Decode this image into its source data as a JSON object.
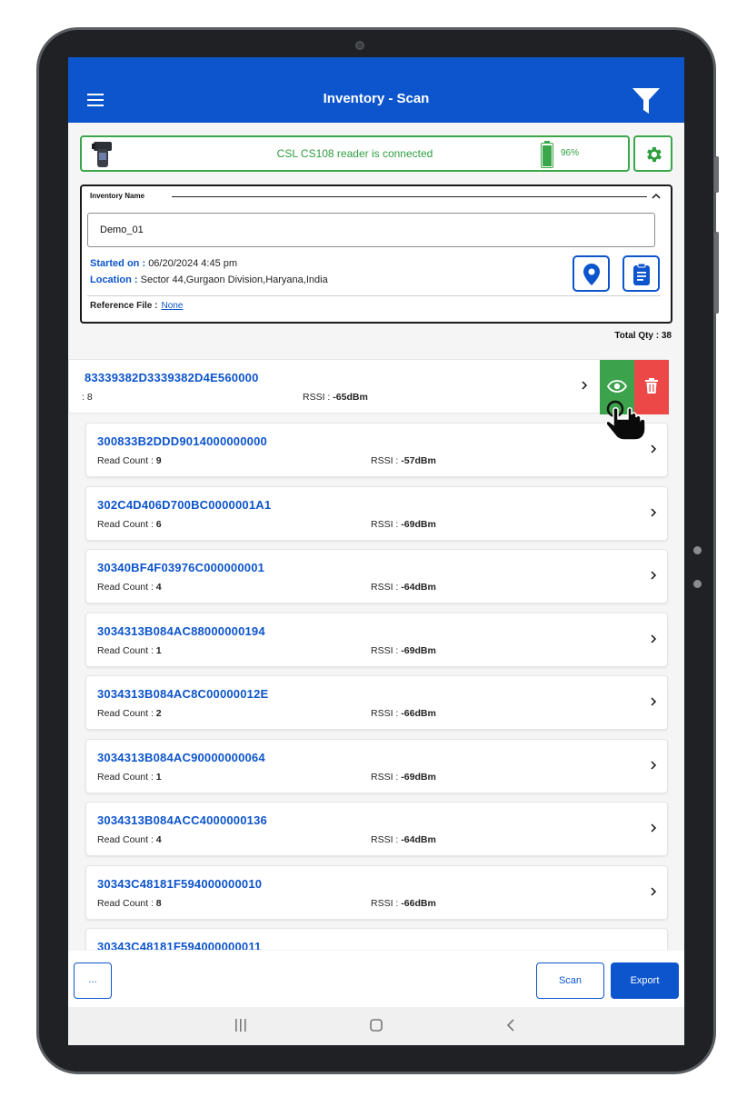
{
  "header": {
    "title": "Inventory - Scan",
    "menu_icon": "hamburger-menu-icon",
    "filter_icon": "filter-funnel-icon"
  },
  "connection": {
    "status_text": "CSL CS108 reader is connected",
    "battery_percent": "96%",
    "battery_level": 0.96,
    "status_color": "#3aa84a"
  },
  "inventory": {
    "name_label": "Inventory Name",
    "name_value": "Demo_01",
    "started_label": "Started on :",
    "started_value": "06/20/2024 4:45 pm",
    "location_label": "Location :",
    "location_value": "Sector 44,Gurgaon Division,Haryana,India",
    "reference_label": "Reference File :",
    "reference_value": "None"
  },
  "total_qty": "Total Qty : 38",
  "swiped_tag": {
    "epc": "83339382D3339382D4E560000",
    "read_count_partial": ": 8",
    "rssi_label": "RSSI :",
    "rssi_value": "-65dBm"
  },
  "read_count_label": "Read Count :",
  "rssi_label": "RSSI :",
  "tags": [
    {
      "epc": "300833B2DDD9014000000000",
      "count": "9",
      "rssi": "-57dBm"
    },
    {
      "epc": "302C4D406D700BC0000001A1",
      "count": "6",
      "rssi": "-69dBm"
    },
    {
      "epc": "30340BF4F03976C000000001",
      "count": "4",
      "rssi": "-64dBm"
    },
    {
      "epc": "3034313B084AC88000000194",
      "count": "1",
      "rssi": "-69dBm"
    },
    {
      "epc": "3034313B084AC8C00000012E",
      "count": "2",
      "rssi": "-66dBm"
    },
    {
      "epc": "3034313B084AC90000000064",
      "count": "1",
      "rssi": "-69dBm"
    },
    {
      "epc": "3034313B084ACC4000000136",
      "count": "4",
      "rssi": "-64dBm"
    },
    {
      "epc": "30343C48181F594000000010",
      "count": "8",
      "rssi": "-66dBm"
    },
    {
      "epc": "30343C48181F594000000011",
      "count": "",
      "rssi": ""
    }
  ],
  "bottom": {
    "more_label": "...",
    "scan_label": "Scan",
    "export_label": "Export"
  },
  "colors": {
    "brand": "#0d55cc",
    "view_action": "#3ca24b",
    "delete_action": "#ec4848"
  }
}
